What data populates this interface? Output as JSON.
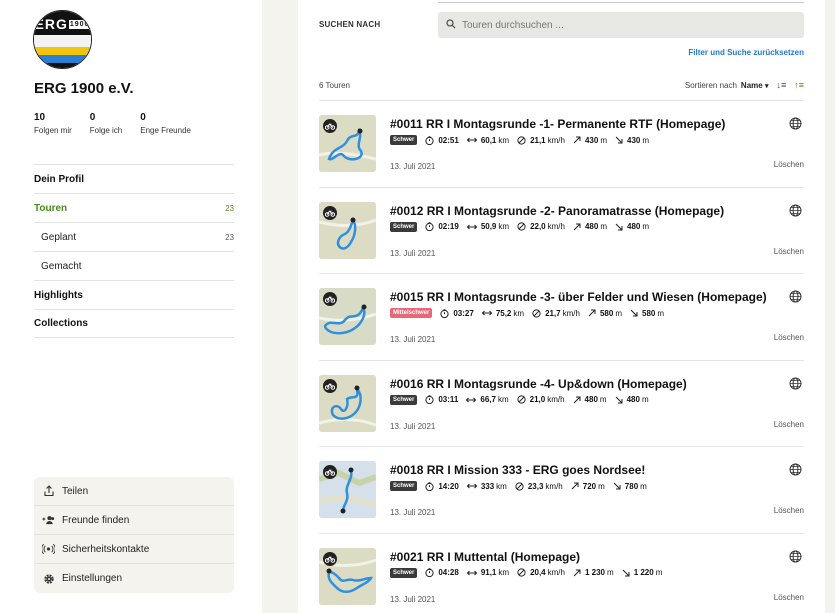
{
  "profile": {
    "logo_text": "ERG",
    "logo_small": "1900",
    "name": "ERG 1900 e.V.",
    "stats": [
      {
        "num": "10",
        "label": "Folgen mir"
      },
      {
        "num": "0",
        "label": "Folge ich"
      },
      {
        "num": "0",
        "label": "Enge Freunde"
      }
    ]
  },
  "nav": {
    "profile": "Dein Profil",
    "tours": "Touren",
    "tours_count": "23",
    "planned": "Geplant",
    "planned_count": "23",
    "done": "Gemacht",
    "highlights": "Highlights",
    "collections": "Collections"
  },
  "actions": {
    "share": "Teilen",
    "find_friends": "Freunde finden",
    "safety": "Sicherheitskontakte",
    "settings": "Einstellungen"
  },
  "search": {
    "label": "SUCHEN NACH",
    "placeholder": "Touren durchsuchen ...",
    "reset": "Filter und Suche zurücksetzen"
  },
  "list": {
    "count": "6 Touren",
    "sort_label": "Sortieren nach",
    "sort_value": "Name",
    "sort_caret": "▾",
    "sort_alpha": "↓≡",
    "sort_dir": "↑≡",
    "tours": [
      {
        "title": "#0011 RR I Montagsrunde -1- Permanente RTF (Homepage)",
        "difficulty": "Schwer",
        "duration": "02:51",
        "distance": "60,1",
        "dist_unit": "km",
        "speed": "21,1",
        "speed_unit": "km/h",
        "up": "430",
        "up_unit": "m",
        "down": "430",
        "down_unit": "m",
        "date": "13. Juli 2021",
        "delete": "Löschen"
      },
      {
        "title": "#0012 RR I Montagsrunde -2- Panoramatrasse (Homepage)",
        "difficulty": "Schwer",
        "duration": "02:19",
        "distance": "50,9",
        "dist_unit": "km",
        "speed": "22,0",
        "speed_unit": "km/h",
        "up": "480",
        "up_unit": "m",
        "down": "480",
        "down_unit": "m",
        "date": "13. Juli 2021",
        "delete": "Löschen"
      },
      {
        "title": "#0015 RR I Montagsrunde -3- über Felder und Wiesen (Homepage)",
        "difficulty": "Mittelschwer",
        "duration": "03:27",
        "distance": "75,2",
        "dist_unit": "km",
        "speed": "21,7",
        "speed_unit": "km/h",
        "up": "580",
        "up_unit": "m",
        "down": "580",
        "down_unit": "m",
        "date": "13. Juli 2021",
        "delete": "Löschen"
      },
      {
        "title": "#0016 RR I Montagsrunde -4- Up&down (Homepage)",
        "difficulty": "Schwer",
        "duration": "03:11",
        "distance": "66,7",
        "dist_unit": "km",
        "speed": "21,0",
        "speed_unit": "km/h",
        "up": "480",
        "up_unit": "m",
        "down": "480",
        "down_unit": "m",
        "date": "13. Juli 2021",
        "delete": "Löschen"
      },
      {
        "title": "#0018 RR I Mission 333 - ERG goes Nordsee!",
        "difficulty": "Schwer",
        "duration": "14:20",
        "distance": "333",
        "dist_unit": "km",
        "speed": "23,3",
        "speed_unit": "km/h",
        "up": "720",
        "up_unit": "m",
        "down": "780",
        "down_unit": "m",
        "date": "13. Juli 2021",
        "delete": "Löschen"
      },
      {
        "title": "#0021 RR I Muttental (Homepage)",
        "difficulty": "Schwer",
        "duration": "04:28",
        "distance": "91,1",
        "dist_unit": "km",
        "speed": "20,4",
        "speed_unit": "km/h",
        "up": "1 230",
        "up_unit": "m",
        "down": "1 220",
        "down_unit": "m",
        "date": "13. Juli 2021",
        "delete": "Löschen"
      }
    ]
  },
  "colors": {
    "accent_green": "#4a8c1c",
    "link_blue": "#1f7ad2",
    "badge_hard": "#3a3a3a",
    "badge_medium": "#e8687a",
    "route_blue": "#2f8fe0"
  },
  "icons": {
    "search": "search-icon",
    "share": "share-icon",
    "friends": "add-friends-icon",
    "safety": "safety-contacts-icon",
    "settings": "gear-icon",
    "globe": "globe-icon",
    "bike": "bike-icon",
    "clock": "clock-icon",
    "distance": "distance-icon",
    "speed": "speed-icon",
    "up": "uphill-icon",
    "down": "downhill-icon"
  }
}
